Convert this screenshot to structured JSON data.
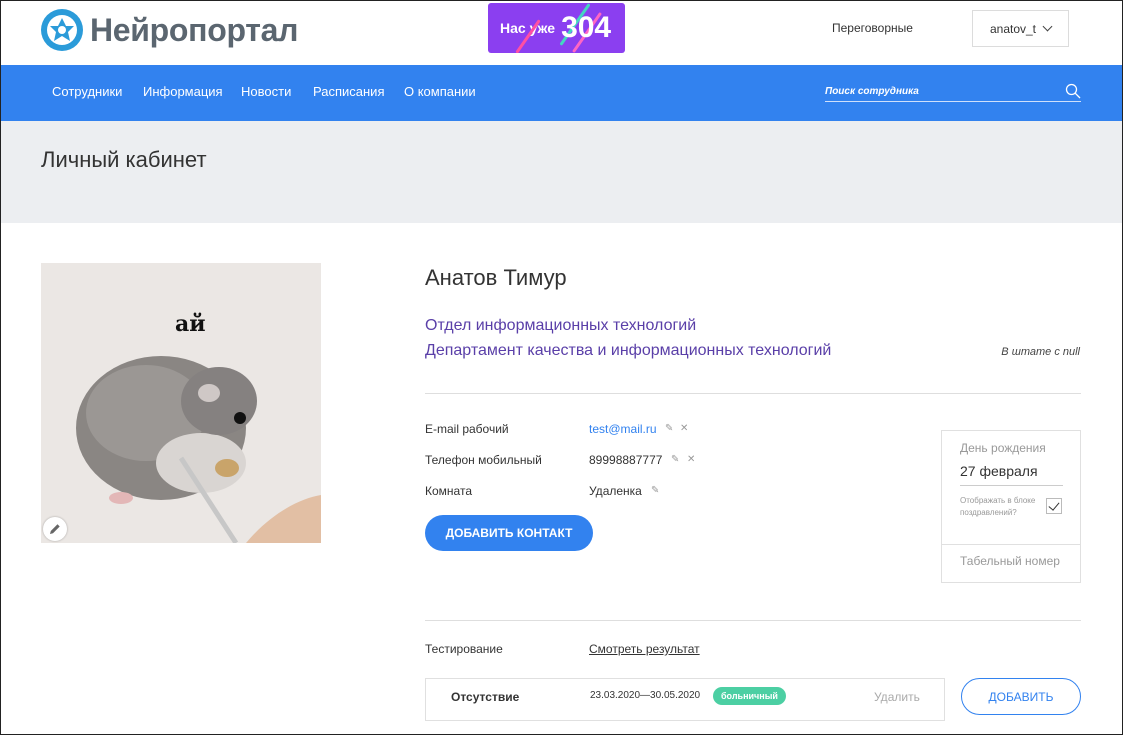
{
  "header": {
    "logo_text": "Нейропортал",
    "counter_prefix": "Нас уже",
    "counter_value": "304",
    "rooms_link": "Переговорные",
    "username": "anatov_t"
  },
  "nav": {
    "items": [
      {
        "label": "Сотрудники"
      },
      {
        "label": "Информация"
      },
      {
        "label": "Новости"
      },
      {
        "label": "Расписания"
      },
      {
        "label": "О компании"
      }
    ],
    "search_placeholder": "Поиск сотрудника"
  },
  "page": {
    "title": "Личный кабинет"
  },
  "profile": {
    "photo_caption": "ай",
    "name": "Анатов Тимур",
    "department": "Отдел информационных технологий",
    "division": "Департамент качества и информационных технологий",
    "staff_since": "В штате с null",
    "fields": [
      {
        "label": "E-mail рабочий",
        "value": "test@mail.ru"
      },
      {
        "label": "Телефон мобильный",
        "value": "89998887777"
      },
      {
        "label": "Комната",
        "value": "Удаленка"
      }
    ],
    "add_contact_label": "Добавить контакт"
  },
  "birthday": {
    "label": "День рождения",
    "date": "27 февраля",
    "show_in_block": "Отображать в блоке поздравлений?",
    "show_checked": true,
    "tab_number_label": "Табельный номер"
  },
  "testing": {
    "label": "Тестирование",
    "link": "Смотреть результат"
  },
  "absence": {
    "label": "Отсутствие",
    "dates": "23.03.2020—30.05.2020",
    "badge": "больничный",
    "delete_label": "Удалить",
    "add_label": "Добавить"
  },
  "colors": {
    "brand_blue": "#3282ef",
    "counter_purple": "#8b3ff0",
    "dept_purple": "#5a3fa8",
    "badge_green": "#4ccfa3"
  }
}
